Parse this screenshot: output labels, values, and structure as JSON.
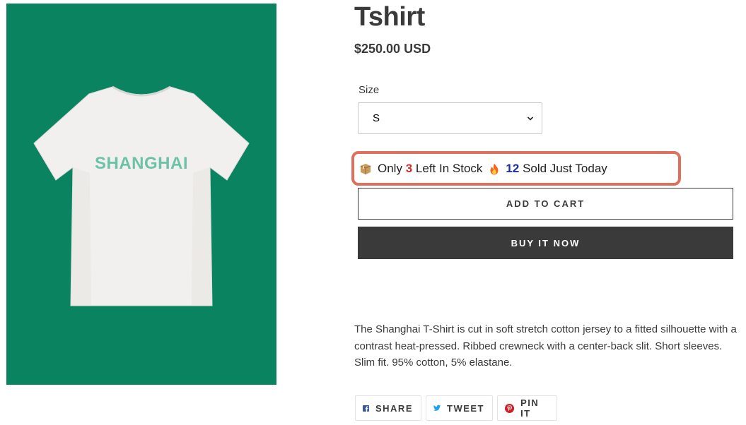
{
  "product": {
    "title": "Tshirt",
    "price": "$250.00 USD",
    "shirt_print": "SHANGHAI",
    "image_bg_color": "#0a8460"
  },
  "size": {
    "label": "Size",
    "selected": "S"
  },
  "stock": {
    "prefix": "Only",
    "left_count": "3",
    "left_suffix": "Left In Stock",
    "sold_count": "12",
    "sold_suffix": "Sold Just Today",
    "box_icon": "package-icon",
    "fire_icon": "fire-icon",
    "highlight_color": "#e0705e"
  },
  "buttons": {
    "add_to_cart": "ADD TO CART",
    "buy_now": "BUY IT NOW"
  },
  "description": "The Shanghai T-Shirt is cut in soft stretch cotton jersey to a fitted silhouette with a contrast heat-pressed. Ribbed crewneck with a center-back slit. Short sleeves. Slim fit. 95% cotton, 5% elastane.",
  "social": {
    "share": "SHARE",
    "tweet": "TWEET",
    "pin": "PIN IT"
  }
}
